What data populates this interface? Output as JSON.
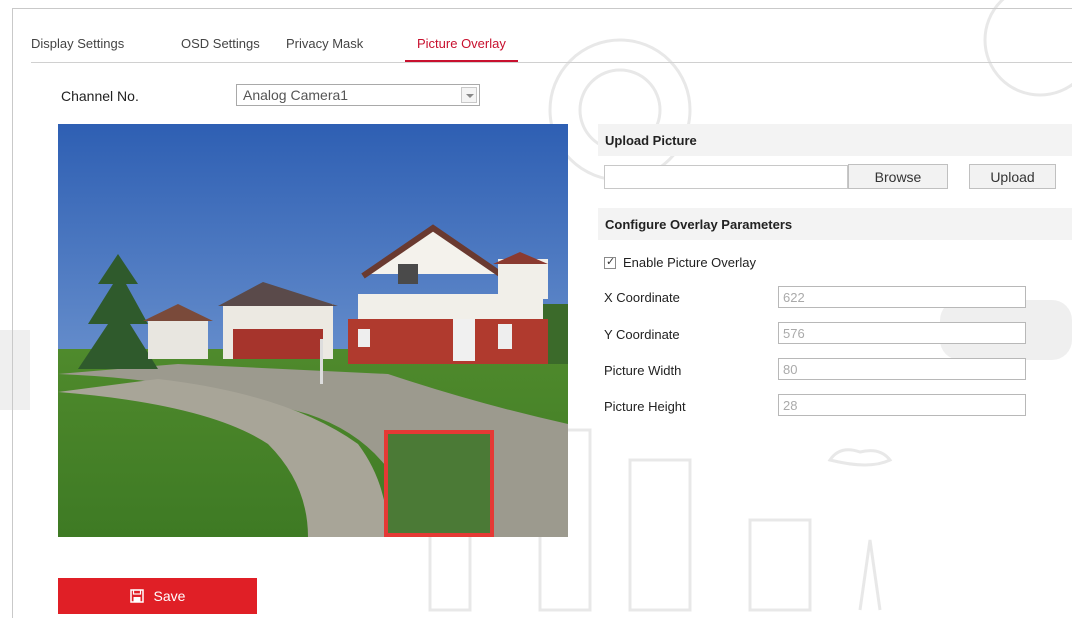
{
  "tabs": [
    {
      "label": "Display Settings"
    },
    {
      "label": "OSD Settings"
    },
    {
      "label": "Privacy Mask"
    },
    {
      "label": "Picture Overlay",
      "active": true
    }
  ],
  "channel": {
    "label": "Channel No.",
    "selected": "Analog Camera1"
  },
  "upload": {
    "heading": "Upload Picture",
    "file_value": "",
    "browse_label": "Browse",
    "upload_label": "Upload"
  },
  "overlay": {
    "heading": "Configure Overlay Parameters",
    "enable_label": "Enable Picture Overlay",
    "enabled": true,
    "x_label": "X Coordinate",
    "x_value": "622",
    "y_label": "Y Coordinate",
    "y_value": "576",
    "width_label": "Picture Width",
    "width_value": "80",
    "height_label": "Picture Height",
    "height_value": "28"
  },
  "save": {
    "label": "Save",
    "icon": "floppy-disk-icon"
  },
  "colors": {
    "accent": "#c8102e",
    "save_bg": "#e01f26",
    "overlay_box": "#e53935"
  }
}
